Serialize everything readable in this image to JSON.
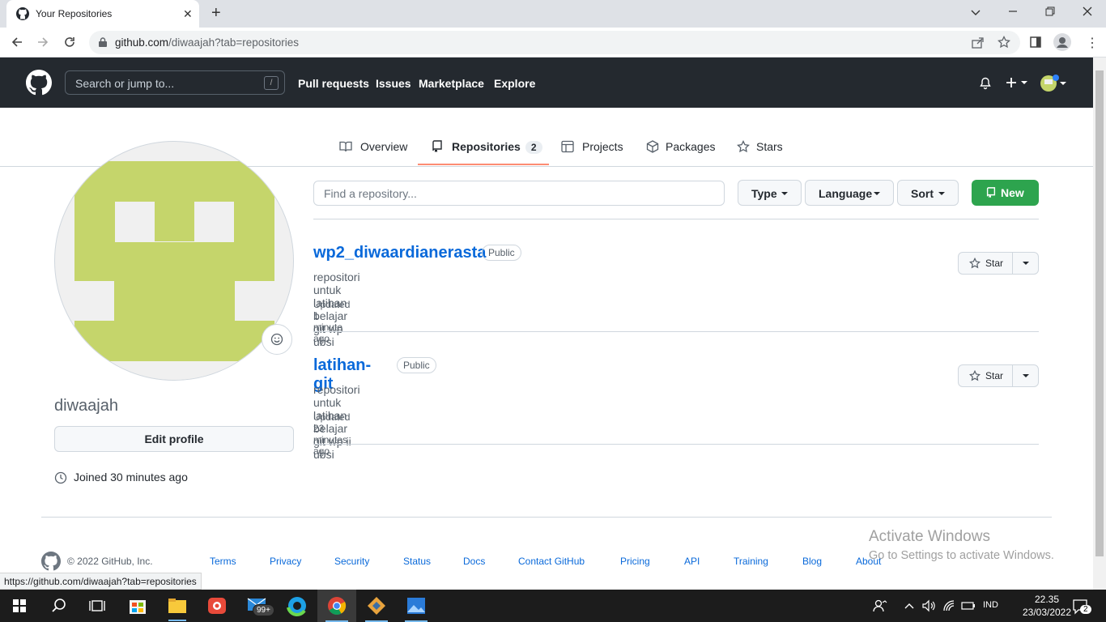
{
  "browser": {
    "tab_title": "Your Repositories",
    "url_host": "github.com",
    "url_path": "/diwaajah?tab=repositories",
    "status_url": "https://github.com/diwaajah?tab=repositories"
  },
  "header": {
    "search_placeholder": "Search or jump to...",
    "search_key": "/",
    "nav": [
      "Pull requests",
      "Issues",
      "Marketplace",
      "Explore"
    ]
  },
  "profile_tabs": [
    {
      "label": "Overview"
    },
    {
      "label": "Repositories",
      "count": "2"
    },
    {
      "label": "Projects"
    },
    {
      "label": "Packages"
    },
    {
      "label": "Stars"
    }
  ],
  "profile": {
    "username": "diwaajah",
    "edit_label": "Edit profile",
    "joined": "Joined 30 minutes ago",
    "avatar_color": "#c5d56b"
  },
  "filters": {
    "find_placeholder": "Find a repository...",
    "type_label": "Type",
    "language_label": "Language",
    "sort_label": "Sort",
    "new_label": "New"
  },
  "repos": [
    {
      "name": "wp2_diwaardianerasta",
      "visibility": "Public",
      "description": "repositori untuk latihan belajar git wp ubsi",
      "updated": "Updated 1 minute ago",
      "star_label": "Star"
    },
    {
      "name": "latihan-git",
      "visibility": "Public",
      "description": "repositori untuk latihan belajar git wp ii ubsi",
      "updated": "Updated 23 minutes ago",
      "star_label": "Star"
    }
  ],
  "footer": {
    "copyright": "© 2022 GitHub, Inc.",
    "links": [
      "Terms",
      "Privacy",
      "Security",
      "Status",
      "Docs",
      "Contact GitHub",
      "Pricing",
      "API",
      "Training",
      "Blog",
      "About"
    ]
  },
  "watermark": {
    "line1": "Activate Windows",
    "line2": "Go to Settings to activate Windows."
  },
  "taskbar": {
    "mail_badge": "99+",
    "language": "IND",
    "time": "22.35",
    "date": "23/03/2022",
    "notifications": "2"
  }
}
